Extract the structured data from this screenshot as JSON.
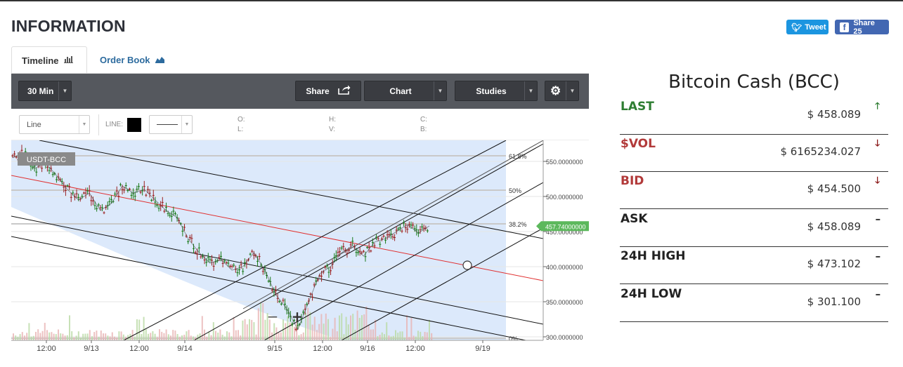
{
  "page": {
    "heading": "INFORMATION"
  },
  "social": {
    "tweet_label": "Tweet",
    "share_label": "Share 25"
  },
  "tabs": [
    {
      "label": "Timeline",
      "icon": "bar-chart-icon"
    },
    {
      "label": "Order Book",
      "icon": "area-chart-icon"
    }
  ],
  "toolbar": {
    "interval": "30 Min",
    "share": "Share",
    "chart": "Chart",
    "studies": "Studies"
  },
  "options": {
    "type": "Line",
    "line_label": "LINE:",
    "ohlc": {
      "o": "O:",
      "h": "H:",
      "c": "C:",
      "l": "L:",
      "v": "V:",
      "b": "B:"
    }
  },
  "chart": {
    "symbol": "USDT-BCC",
    "price_tag": "457.74000000",
    "zoom_out": "−",
    "zoom_in": "+",
    "y_ticks": [
      "550.0000000",
      "500.0000000",
      "450.0000000",
      "400.0000000",
      "350.0000000",
      "300.0000000"
    ],
    "x_ticks": [
      "12:00",
      "9/13",
      "12:00",
      "9/14",
      "9/15",
      "12:00",
      "9/16",
      "12:00",
      "9/19"
    ],
    "fib_levels": [
      "61.8%",
      "50%",
      "38.2%",
      "0%"
    ],
    "colors": {
      "up": "#1a7a1a",
      "down": "#b03030",
      "price_line": "#5cb85c",
      "regression": "#e03030"
    }
  },
  "chart_data": {
    "type": "line",
    "title": "USDT-BCC",
    "series": [
      {
        "name": "USDT-BCC",
        "values": [
          555,
          562,
          540,
          548,
          530,
          510,
          495,
          505,
          480,
          490,
          515,
          505,
          510,
          495,
          480,
          470,
          440,
          420,
          405,
          410,
          395,
          400,
          420,
          395,
          360,
          340,
          310,
          350,
          390,
          400,
          420,
          430,
          415,
          435,
          440,
          450,
          460,
          448,
          458
        ]
      }
    ],
    "x_ticks": [
      "12:00",
      "9/13",
      "12:00",
      "9/14",
      "9/15",
      "12:00",
      "9/16",
      "12:00",
      "9/19"
    ],
    "y_ticks": [
      "550.0000000",
      "500.0000000",
      "450.0000000",
      "400.0000000",
      "350.0000000",
      "300.0000000"
    ],
    "ylim": [
      295,
      580
    ],
    "last_price": 457.74
  },
  "ticker": {
    "coin": "Bitcoin Cash (BCC)",
    "rows": [
      {
        "label": "LAST",
        "value": "$ 458.089",
        "color": "#2e7d32",
        "arrow": "up-arrow-icon",
        "glyph": "🡑",
        "arrow_color": "#2e7d32"
      },
      {
        "label": "$VOL",
        "value": "$ 6165234.027",
        "color": "#b23a3a",
        "arrow": "down-arrow-icon",
        "glyph": "🡓",
        "arrow_color": "#8b1a1a"
      },
      {
        "label": "BID",
        "value": "$ 454.500",
        "color": "#b23a3a",
        "arrow": "down-arrow-icon",
        "glyph": "🡓",
        "arrow_color": "#8b1a1a"
      },
      {
        "label": "ASK",
        "value": "$ 458.089",
        "color": "#222222",
        "arrow": "dash-icon",
        "glyph": "━",
        "arrow_color": "#333333"
      },
      {
        "label": "24H HIGH",
        "value": "$ 473.102",
        "color": "#222222",
        "arrow": "dash-icon",
        "glyph": "━",
        "arrow_color": "#333333"
      },
      {
        "label": "24H LOW",
        "value": "$ 301.100",
        "color": "#222222",
        "arrow": "dash-icon",
        "glyph": "━",
        "arrow_color": "#333333"
      }
    ]
  }
}
